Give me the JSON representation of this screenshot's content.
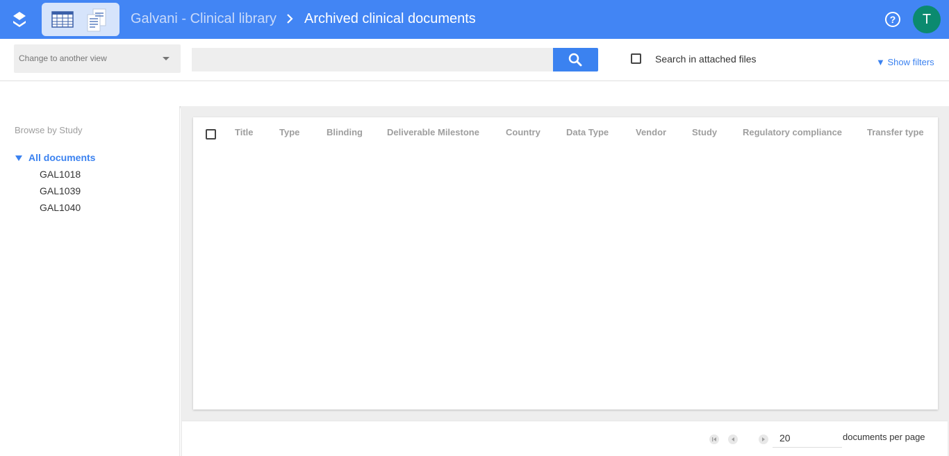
{
  "header": {
    "library": "Galvani - Clinical library",
    "current_view": "Archived clinical documents",
    "help_symbol": "?",
    "avatar_initial": "T",
    "colors": {
      "bar": "#4285f4",
      "avatar": "#0b8a6f"
    }
  },
  "toolbar": {
    "view_select_placeholder": "Change to another view",
    "search_placeholder": "",
    "search_attached_label": "Search in attached files",
    "search_attached_checked": false,
    "show_filters_label": "▼ Show filters"
  },
  "sidebar": {
    "title": "Browse by Study",
    "all_documents": "All documents",
    "items": [
      {
        "label": "GAL1018"
      },
      {
        "label": "GAL1039"
      },
      {
        "label": "GAL1040"
      }
    ]
  },
  "table": {
    "columns": [
      "Title",
      "Type",
      "Blinding",
      "Deliverable Milestone",
      "Country",
      "Data Type",
      "Vendor",
      "Study",
      "Regulatory compliance",
      "Transfer type"
    ],
    "rows": []
  },
  "pager": {
    "per_page_value": "20",
    "per_page_label": "documents per page"
  },
  "icons": [
    "layers-icon",
    "grid-view-icon",
    "documents-view-icon",
    "chevron-right-icon",
    "help-icon",
    "search-icon",
    "first-page-icon",
    "previous-page-icon",
    "next-page-icon"
  ]
}
